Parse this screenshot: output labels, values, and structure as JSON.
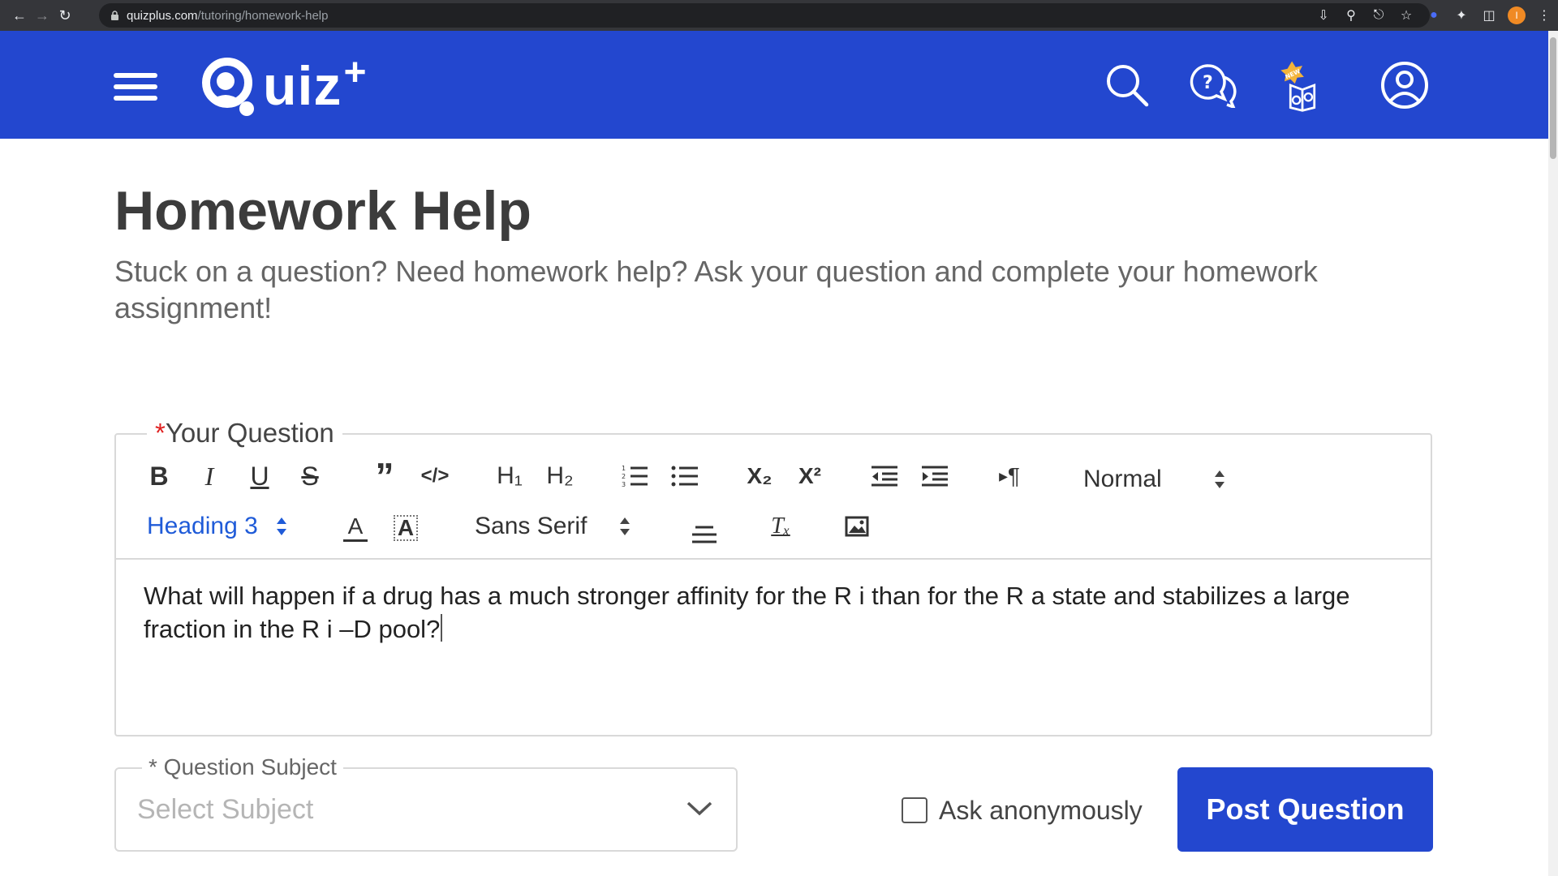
{
  "browser": {
    "url_host": "quizplus.com",
    "url_path": "/tutoring/homework-help",
    "profile_initial": "I"
  },
  "header": {
    "logo_text": "uiz",
    "logo_plus": "+",
    "brand_color": "#2347cf",
    "icons": [
      "search-icon",
      "help-chat-icon",
      "new-feature-book-icon",
      "user-account-icon"
    ],
    "new_badge": "NEW"
  },
  "main": {
    "title": "Homework Help",
    "subtitle": "Stuck on a question? Need homework help? Ask your question and complete your homework assignment!"
  },
  "editor": {
    "required_mark": "*",
    "legend": "Your Question",
    "toolbar": {
      "bold": "B",
      "italic": "I",
      "underline": "U",
      "strike": "S",
      "blockquote": "”",
      "code": "</>",
      "h1": "H₁",
      "h2": "H₂",
      "subscript": "X₂",
      "superscript": "X²",
      "direction": "¶",
      "size_select": "Normal",
      "header_select": "Heading 3",
      "color": "A",
      "background": "A",
      "font_select": "Sans Serif",
      "clean": "Tₓ"
    },
    "content": "What will happen if a drug has a much stronger affinity for the R i than for the R a state and stabilizes a large fraction in the R i –D pool?"
  },
  "subject": {
    "legend": "* Question Subject",
    "placeholder": "Select Subject"
  },
  "anonymous": {
    "label": "Ask anonymously",
    "checked": false
  },
  "post_button": {
    "label": "Post Question"
  }
}
